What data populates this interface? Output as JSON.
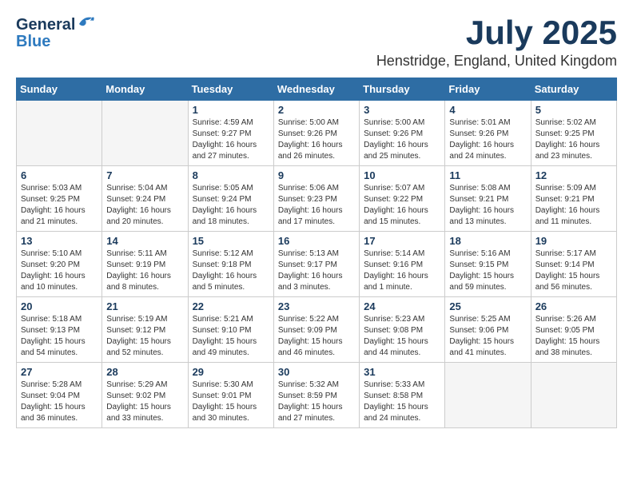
{
  "header": {
    "logo_general": "General",
    "logo_blue": "Blue",
    "month_year": "July 2025",
    "location": "Henstridge, England, United Kingdom"
  },
  "weekdays": [
    "Sunday",
    "Monday",
    "Tuesday",
    "Wednesday",
    "Thursday",
    "Friday",
    "Saturday"
  ],
  "weeks": [
    [
      {
        "day": "",
        "info": ""
      },
      {
        "day": "",
        "info": ""
      },
      {
        "day": "1",
        "info": "Sunrise: 4:59 AM\nSunset: 9:27 PM\nDaylight: 16 hours\nand 27 minutes."
      },
      {
        "day": "2",
        "info": "Sunrise: 5:00 AM\nSunset: 9:26 PM\nDaylight: 16 hours\nand 26 minutes."
      },
      {
        "day": "3",
        "info": "Sunrise: 5:00 AM\nSunset: 9:26 PM\nDaylight: 16 hours\nand 25 minutes."
      },
      {
        "day": "4",
        "info": "Sunrise: 5:01 AM\nSunset: 9:26 PM\nDaylight: 16 hours\nand 24 minutes."
      },
      {
        "day": "5",
        "info": "Sunrise: 5:02 AM\nSunset: 9:25 PM\nDaylight: 16 hours\nand 23 minutes."
      }
    ],
    [
      {
        "day": "6",
        "info": "Sunrise: 5:03 AM\nSunset: 9:25 PM\nDaylight: 16 hours\nand 21 minutes."
      },
      {
        "day": "7",
        "info": "Sunrise: 5:04 AM\nSunset: 9:24 PM\nDaylight: 16 hours\nand 20 minutes."
      },
      {
        "day": "8",
        "info": "Sunrise: 5:05 AM\nSunset: 9:24 PM\nDaylight: 16 hours\nand 18 minutes."
      },
      {
        "day": "9",
        "info": "Sunrise: 5:06 AM\nSunset: 9:23 PM\nDaylight: 16 hours\nand 17 minutes."
      },
      {
        "day": "10",
        "info": "Sunrise: 5:07 AM\nSunset: 9:22 PM\nDaylight: 16 hours\nand 15 minutes."
      },
      {
        "day": "11",
        "info": "Sunrise: 5:08 AM\nSunset: 9:21 PM\nDaylight: 16 hours\nand 13 minutes."
      },
      {
        "day": "12",
        "info": "Sunrise: 5:09 AM\nSunset: 9:21 PM\nDaylight: 16 hours\nand 11 minutes."
      }
    ],
    [
      {
        "day": "13",
        "info": "Sunrise: 5:10 AM\nSunset: 9:20 PM\nDaylight: 16 hours\nand 10 minutes."
      },
      {
        "day": "14",
        "info": "Sunrise: 5:11 AM\nSunset: 9:19 PM\nDaylight: 16 hours\nand 8 minutes."
      },
      {
        "day": "15",
        "info": "Sunrise: 5:12 AM\nSunset: 9:18 PM\nDaylight: 16 hours\nand 5 minutes."
      },
      {
        "day": "16",
        "info": "Sunrise: 5:13 AM\nSunset: 9:17 PM\nDaylight: 16 hours\nand 3 minutes."
      },
      {
        "day": "17",
        "info": "Sunrise: 5:14 AM\nSunset: 9:16 PM\nDaylight: 16 hours\nand 1 minute."
      },
      {
        "day": "18",
        "info": "Sunrise: 5:16 AM\nSunset: 9:15 PM\nDaylight: 15 hours\nand 59 minutes."
      },
      {
        "day": "19",
        "info": "Sunrise: 5:17 AM\nSunset: 9:14 PM\nDaylight: 15 hours\nand 56 minutes."
      }
    ],
    [
      {
        "day": "20",
        "info": "Sunrise: 5:18 AM\nSunset: 9:13 PM\nDaylight: 15 hours\nand 54 minutes."
      },
      {
        "day": "21",
        "info": "Sunrise: 5:19 AM\nSunset: 9:12 PM\nDaylight: 15 hours\nand 52 minutes."
      },
      {
        "day": "22",
        "info": "Sunrise: 5:21 AM\nSunset: 9:10 PM\nDaylight: 15 hours\nand 49 minutes."
      },
      {
        "day": "23",
        "info": "Sunrise: 5:22 AM\nSunset: 9:09 PM\nDaylight: 15 hours\nand 46 minutes."
      },
      {
        "day": "24",
        "info": "Sunrise: 5:23 AM\nSunset: 9:08 PM\nDaylight: 15 hours\nand 44 minutes."
      },
      {
        "day": "25",
        "info": "Sunrise: 5:25 AM\nSunset: 9:06 PM\nDaylight: 15 hours\nand 41 minutes."
      },
      {
        "day": "26",
        "info": "Sunrise: 5:26 AM\nSunset: 9:05 PM\nDaylight: 15 hours\nand 38 minutes."
      }
    ],
    [
      {
        "day": "27",
        "info": "Sunrise: 5:28 AM\nSunset: 9:04 PM\nDaylight: 15 hours\nand 36 minutes."
      },
      {
        "day": "28",
        "info": "Sunrise: 5:29 AM\nSunset: 9:02 PM\nDaylight: 15 hours\nand 33 minutes."
      },
      {
        "day": "29",
        "info": "Sunrise: 5:30 AM\nSunset: 9:01 PM\nDaylight: 15 hours\nand 30 minutes."
      },
      {
        "day": "30",
        "info": "Sunrise: 5:32 AM\nSunset: 8:59 PM\nDaylight: 15 hours\nand 27 minutes."
      },
      {
        "day": "31",
        "info": "Sunrise: 5:33 AM\nSunset: 8:58 PM\nDaylight: 15 hours\nand 24 minutes."
      },
      {
        "day": "",
        "info": ""
      },
      {
        "day": "",
        "info": ""
      }
    ]
  ]
}
